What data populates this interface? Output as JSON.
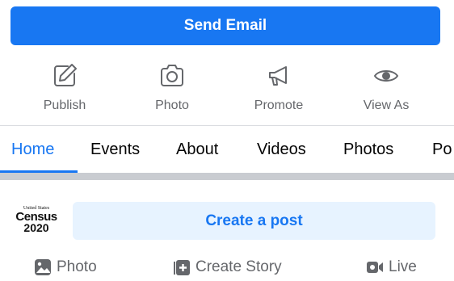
{
  "primary_button": {
    "label": "Send Email",
    "color": "#1877f2"
  },
  "actions": [
    {
      "label": "Publish",
      "icon": "pencil-square-icon"
    },
    {
      "label": "Photo",
      "icon": "camera-icon"
    },
    {
      "label": "Promote",
      "icon": "megaphone-icon"
    },
    {
      "label": "View As",
      "icon": "eye-icon"
    }
  ],
  "tabs": [
    {
      "label": "Home",
      "active": true
    },
    {
      "label": "Events"
    },
    {
      "label": "About"
    },
    {
      "label": "Videos"
    },
    {
      "label": "Photos"
    },
    {
      "label": "Po"
    }
  ],
  "composer": {
    "avatar_logo": {
      "line1": "United States",
      "line2": "Census",
      "line3": "2020"
    },
    "create_post_label": "Create a post"
  },
  "composer_actions": [
    {
      "label": "Photo",
      "icon": "image-icon"
    },
    {
      "label": "Create Story",
      "icon": "story-plus-icon"
    },
    {
      "label": "Live",
      "icon": "video-camera-icon"
    }
  ],
  "colors": {
    "accent": "#1877f2",
    "secondary_text": "#65676b",
    "light_accent_bg": "#e7f3ff"
  }
}
